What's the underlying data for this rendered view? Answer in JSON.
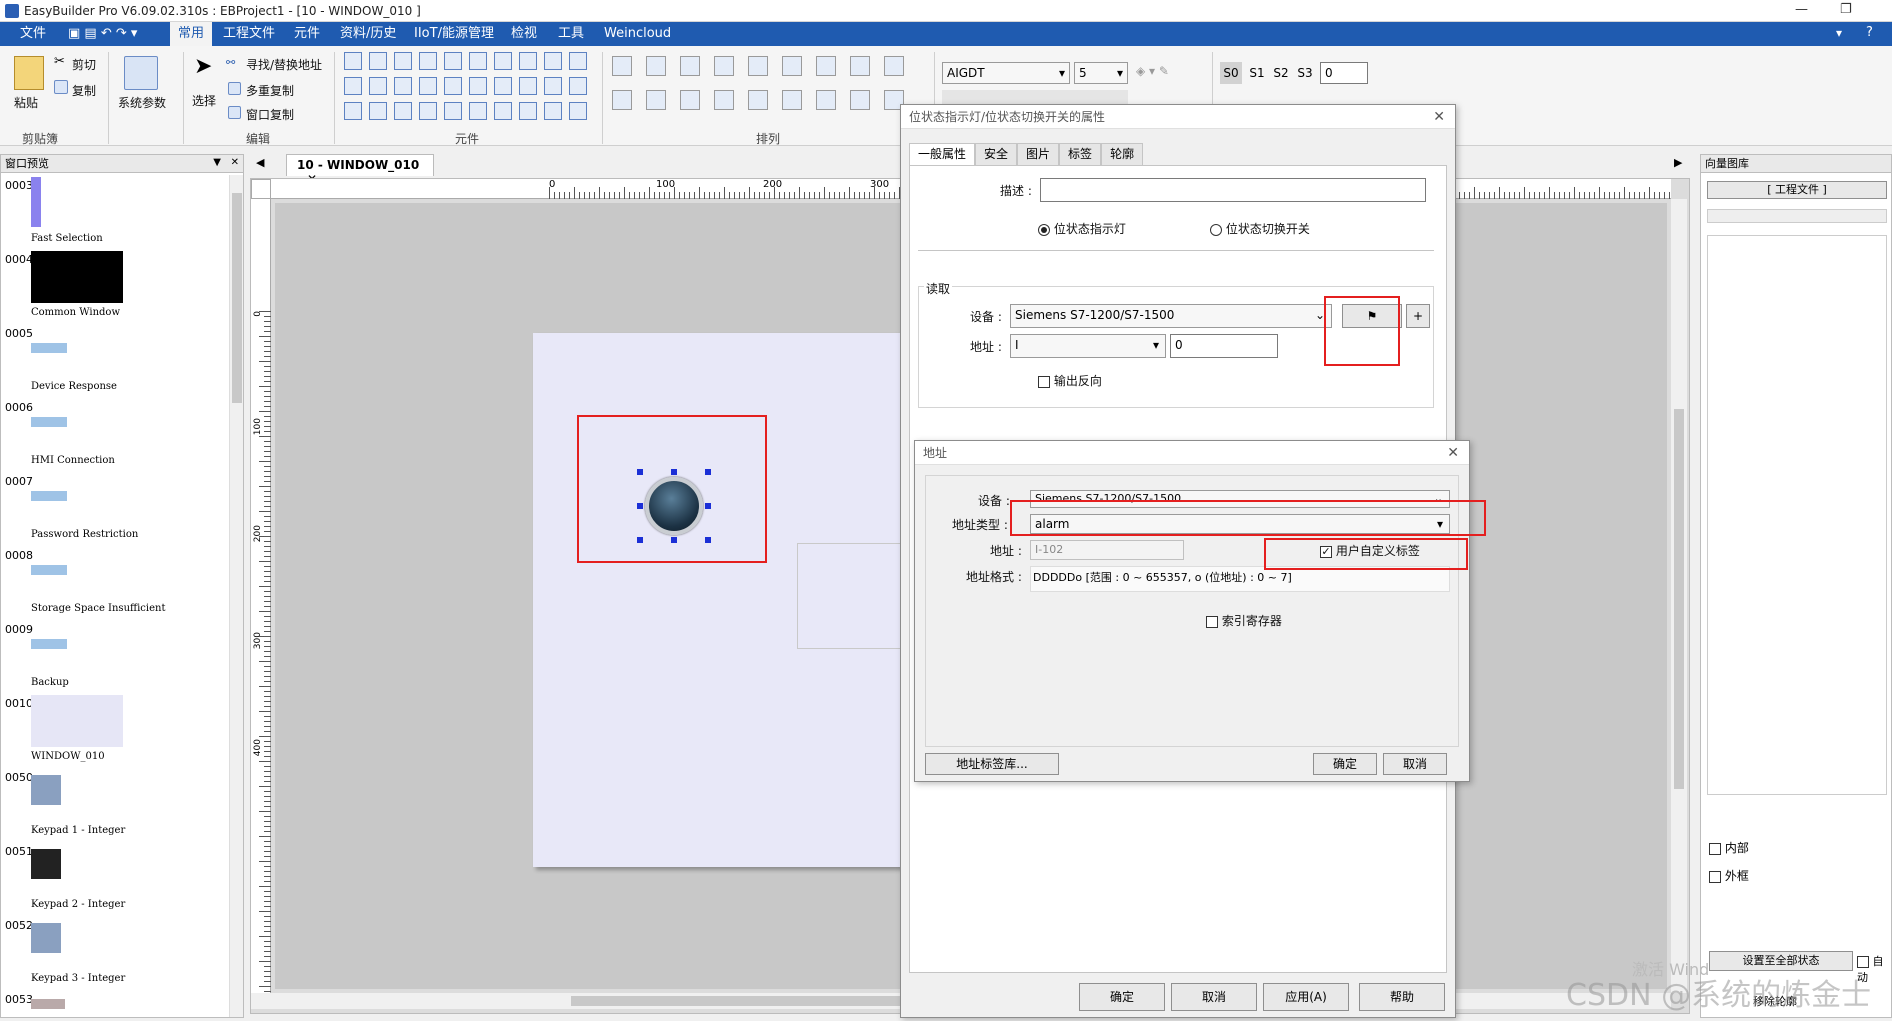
{
  "window": {
    "title": "EasyBuilder Pro V6.09.02.310s : EBProject1 - [10 - WINDOW_010 ]"
  },
  "menu": [
    "文件",
    "常用",
    "工程文件",
    "元件",
    "资料/历史",
    "IIoT/能源管理",
    "检视",
    "工具",
    "Weincloud"
  ],
  "ribbon": {
    "clipboard": {
      "paste": "粘贴",
      "cut": "剪切",
      "copy": "复制",
      "group": "剪贴簿"
    },
    "sys": {
      "label": "系统参数"
    },
    "edit": {
      "select": "选择",
      "find_replace": "寻找/替换地址",
      "multi_copy": "多重复制",
      "window_copy": "窗口复制",
      "group": "编辑"
    },
    "objects_group": "元件",
    "arrange_group": "排列",
    "font_name": "AIGDT",
    "font_size": "5",
    "states": [
      "S0",
      "S1",
      "S2",
      "S3"
    ],
    "state_value": "0"
  },
  "left_panel": {
    "title": "窗口预览",
    "items": [
      {
        "num": "0003",
        "label": "Fast Selection"
      },
      {
        "num": "0004",
        "label": "Common Window"
      },
      {
        "num": "0005",
        "label": "Device Response"
      },
      {
        "num": "0006",
        "label": "HMI Connection"
      },
      {
        "num": "0007",
        "label": "Password Restriction"
      },
      {
        "num": "0008",
        "label": "Storage Space Insufficient"
      },
      {
        "num": "0009",
        "label": "Backup"
      },
      {
        "num": "0010",
        "label": "WINDOW_010"
      },
      {
        "num": "0050",
        "label": "Keypad 1 - Integer"
      },
      {
        "num": "0051",
        "label": "Keypad 2 - Integer"
      },
      {
        "num": "0052",
        "label": "Keypad 3 - Integer"
      },
      {
        "num": "0053",
        "label": ""
      }
    ]
  },
  "doc_tab": {
    "label": "10 - WINDOW_010",
    "close": "✕"
  },
  "ruler": {
    "h": [
      "0",
      "100",
      "200",
      "300"
    ],
    "v": [
      "0",
      "100",
      "200",
      "300",
      "400"
    ]
  },
  "right_panel": {
    "title": "向量图库",
    "project_file": "[ 工程文件 ]",
    "internal": "内部",
    "outer": "外框",
    "set_all": "设置至全部状态",
    "auto": "自动",
    "remove": "移除轮廓"
  },
  "dialog1": {
    "title": "位状态指示灯/位状态切换开关的属性",
    "tabs": [
      "一般属性",
      "安全",
      "图片",
      "标签",
      "轮廓"
    ],
    "desc_label": "描述 :",
    "radio1": "位状态指示灯",
    "radio2": "位状态切换开关",
    "read_label": "读取",
    "device_label": "设备 :",
    "device_value": "Siemens S7-1200/S7-1500",
    "addr_label": "地址 :",
    "addr_type": "I",
    "addr_value": "0",
    "invert": "输出反向",
    "ok": "确定",
    "cancel": "取消",
    "apply": "应用(A)",
    "help": "帮助"
  },
  "dialog2": {
    "title": "地址",
    "device_label": "设备 :",
    "device_value": "Siemens S7-1200/S7-1500",
    "type_label": "地址类型 :",
    "type_value": "alarm",
    "addr_label": "地址 :",
    "addr_value": "I-102",
    "user_tag": "用户自定义标签",
    "format_label": "地址格式 :",
    "format_value": "DDDDDo [范围 : 0 ~ 655357, o (位地址) : 0 ~ 7]",
    "index_reg": "索引寄存器",
    "tag_lib": "地址标签库...",
    "ok": "确定",
    "cancel": "取消"
  },
  "watermark": "CSDN @系统的炼金士",
  "activate": "激活 Wind"
}
